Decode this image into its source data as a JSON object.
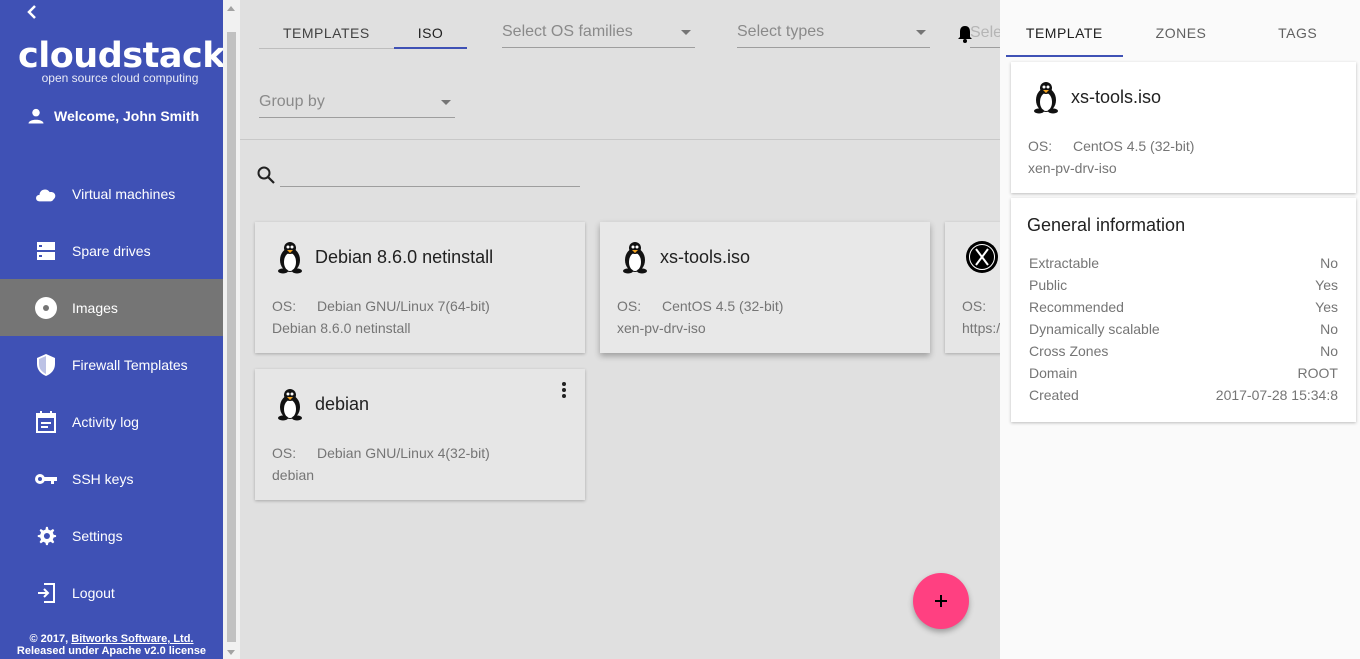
{
  "sidebar": {
    "logo_main": "cloudstack",
    "logo_sub": "open source cloud computing",
    "welcome": "Welcome, John Smith",
    "items": [
      {
        "label": "Virtual machines",
        "icon": "cloud-icon"
      },
      {
        "label": "Spare drives",
        "icon": "storage-icon"
      },
      {
        "label": "Images",
        "icon": "disc-icon",
        "active": true
      },
      {
        "label": "Firewall Templates",
        "icon": "shield-icon"
      },
      {
        "label": "Activity log",
        "icon": "calendar-icon"
      },
      {
        "label": "SSH keys",
        "icon": "key-icon"
      },
      {
        "label": "Settings",
        "icon": "gear-icon"
      },
      {
        "label": "Logout",
        "icon": "logout-icon"
      }
    ],
    "footer_line1_prefix": "© 2017, ",
    "footer_company": "Bitworks Software, Ltd.",
    "footer_line2": "Released under Apache v2.0 license"
  },
  "toolbar": {
    "tabs": [
      {
        "label": "TEMPLATES",
        "active": false
      },
      {
        "label": "ISO",
        "active": true
      }
    ],
    "os_families_placeholder": "Select OS families",
    "types_placeholder": "Select types",
    "truncated_select": "Sele",
    "group_by_placeholder": "Group by"
  },
  "search": {
    "placeholder": ""
  },
  "cards": [
    {
      "title": "Debian 8.6.0 netinstall",
      "os_label": "OS:",
      "os": "Debian GNU/Linux 7(64-bit)",
      "desc": "Debian 8.6.0 netinstall",
      "icon": "linux-tux-icon"
    },
    {
      "title": "xs-tools.iso",
      "os_label": "OS:",
      "os": "CentOS 4.5 (32-bit)",
      "desc": "xen-pv-drv-iso",
      "icon": "linux-tux-icon",
      "selected": true
    },
    {
      "title": "",
      "os_label": "OS:",
      "os": "",
      "desc": "https:/",
      "icon": "x-logo-icon"
    },
    {
      "title": "debian",
      "os_label": "OS:",
      "os": "Debian GNU/Linux 4(32-bit)",
      "desc": "debian",
      "icon": "linux-tux-icon"
    }
  ],
  "panel": {
    "tabs": [
      {
        "label": "TEMPLATE",
        "active": true
      },
      {
        "label": "ZONES",
        "active": false
      },
      {
        "label": "TAGS",
        "active": false
      }
    ],
    "summary": {
      "title": "xs-tools.iso",
      "os_label": "OS:",
      "os": "CentOS 4.5 (32-bit)",
      "desc": "xen-pv-drv-iso"
    },
    "general": {
      "title": "General information",
      "rows": [
        {
          "label": "Extractable",
          "value": "No"
        },
        {
          "label": "Public",
          "value": "Yes"
        },
        {
          "label": "Recommended",
          "value": "Yes"
        },
        {
          "label": "Dynamically scalable",
          "value": "No"
        },
        {
          "label": "Cross Zones",
          "value": "No"
        },
        {
          "label": "Domain",
          "value": "ROOT"
        },
        {
          "label": "Created",
          "value": "2017-07-28 15:34:8"
        }
      ]
    }
  },
  "colors": {
    "sidebar": "#3f51b5",
    "accent": "#ff4081",
    "active_nav": "#757575"
  }
}
